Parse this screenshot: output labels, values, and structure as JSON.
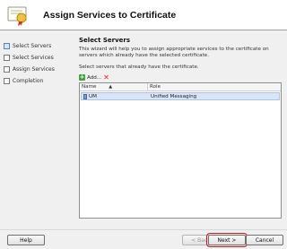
{
  "header": {
    "title": "Assign Services to Certificate"
  },
  "nav": {
    "items": [
      {
        "label": "Select Servers"
      },
      {
        "label": "Select Services"
      },
      {
        "label": "Assign Services"
      },
      {
        "label": "Completion"
      }
    ]
  },
  "content": {
    "title": "Select Servers",
    "description": "This wizard will help you to assign appropriate services to the certificate on servers which already have the selected certificate.",
    "instruction": "Select servers that already have the certificate.",
    "toolbar": {
      "add_label": "Add..."
    },
    "list": {
      "columns": [
        "Name",
        "Role"
      ],
      "rows": [
        {
          "name": "UM",
          "role": "Unified Messaging"
        }
      ]
    }
  },
  "footer": {
    "help_label": "Help",
    "back_label": "< Back",
    "next_label": "Next >",
    "cancel_label": "Cancel"
  },
  "colors": {
    "highlight": "#c3191d",
    "selection": "#d7e5f7"
  }
}
